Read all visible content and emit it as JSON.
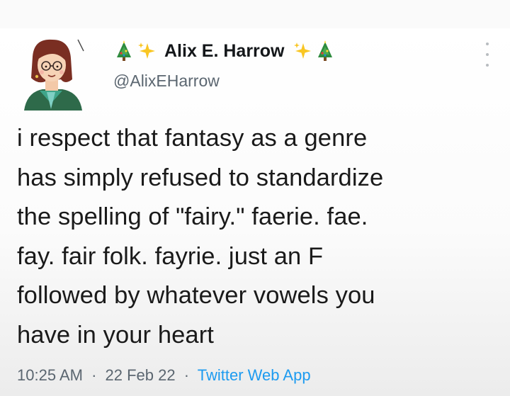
{
  "header": {
    "display_name": "Alix E. Harrow",
    "handle": "@AlixEHarrow",
    "name_decorations": [
      "christmas-tree-emoji",
      "sparkles-emoji",
      "sparkles-emoji",
      "christmas-tree-emoji"
    ],
    "more_icon": "more-dots-vertical-icon"
  },
  "tweet": {
    "text": "i respect that fantasy as a genre\nhas simply refused to standardize\nthe spelling of \"fairy.\" faerie. fae.\nfay. fair folk. fayrie. just an F\nfollowed by whatever vowels you\nhave in your heart"
  },
  "meta": {
    "time": "10:25 AM",
    "separator": "·",
    "date": "22 Feb 22",
    "source": "Twitter Web App"
  },
  "colors": {
    "text": "#14171a",
    "secondary": "#5b6670",
    "link": "#1d9bf0",
    "background": "#ffffff"
  }
}
